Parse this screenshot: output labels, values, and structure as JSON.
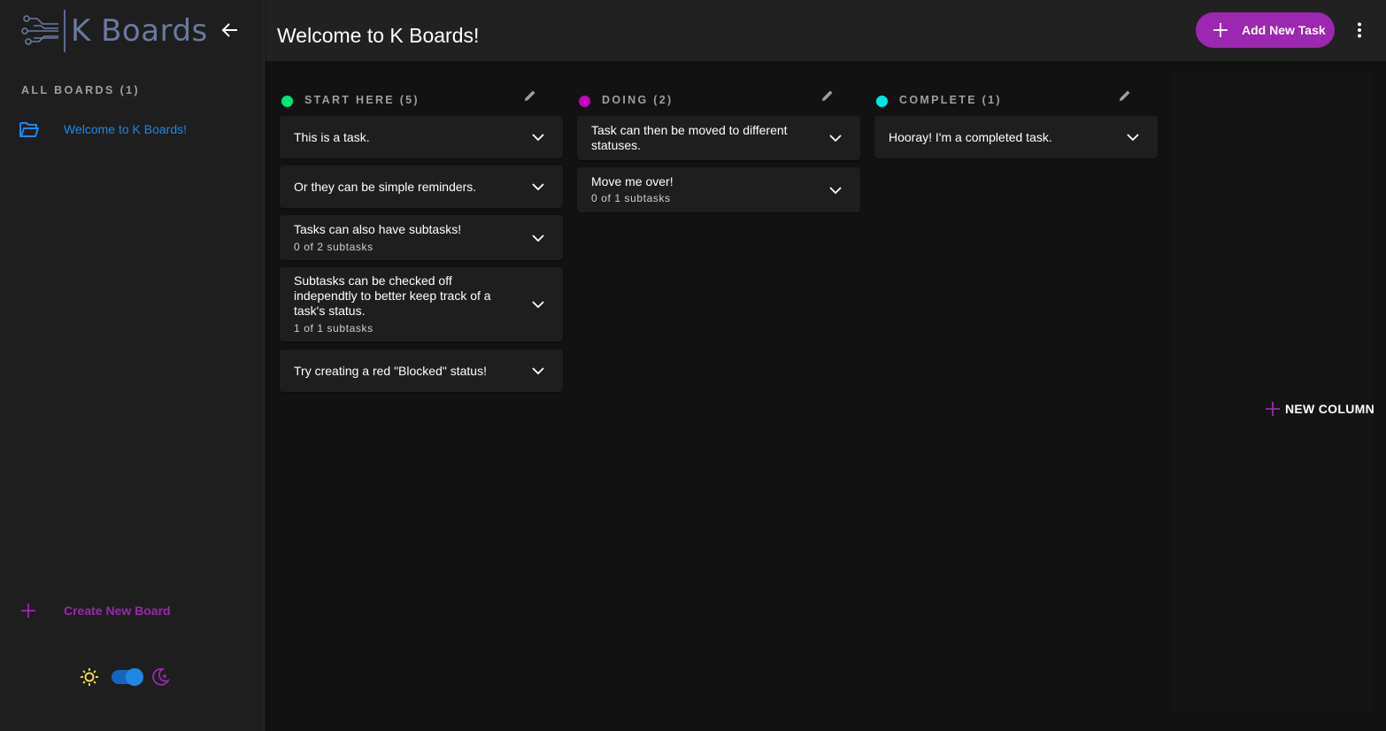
{
  "sidebar": {
    "logo_text": "K Boards",
    "boards_heading": "ALL BOARDS (1)",
    "boards": [
      {
        "label": "Welcome to K Boards!"
      }
    ],
    "create_board_label": "Create New Board",
    "theme": {
      "mode": "dark"
    }
  },
  "header": {
    "title": "Welcome to K Boards!",
    "add_task_label": "Add New Task"
  },
  "columns": [
    {
      "title": "START HERE (5)",
      "color": "#00e676",
      "cards": [
        {
          "title": "This is a task.",
          "subtasks": ""
        },
        {
          "title": "Or they can be simple reminders.",
          "subtasks": ""
        },
        {
          "title": "Tasks can also have subtasks!",
          "subtasks": "0 of 2 subtasks"
        },
        {
          "title": "Subtasks can be checked off independtly to better keep track of a task's status.",
          "subtasks": "1 of 1 subtasks"
        },
        {
          "title": "Try creating a red \"Blocked\" status!",
          "subtasks": ""
        }
      ]
    },
    {
      "title": "DOING (2)",
      "color": "#c300c3",
      "cards": [
        {
          "title": "Task can then be moved to different statuses.",
          "subtasks": ""
        },
        {
          "title": "Move me over!",
          "subtasks": "0 of 1 subtasks"
        }
      ]
    },
    {
      "title": "COMPLETE (1)",
      "color": "#00e5e5",
      "cards": [
        {
          "title": "Hooray! I'm a completed task.",
          "subtasks": ""
        }
      ]
    }
  ],
  "new_column_label": "NEW COLUMN",
  "colors": {
    "accent": "#9c27b0",
    "link": "#1e88e5"
  }
}
